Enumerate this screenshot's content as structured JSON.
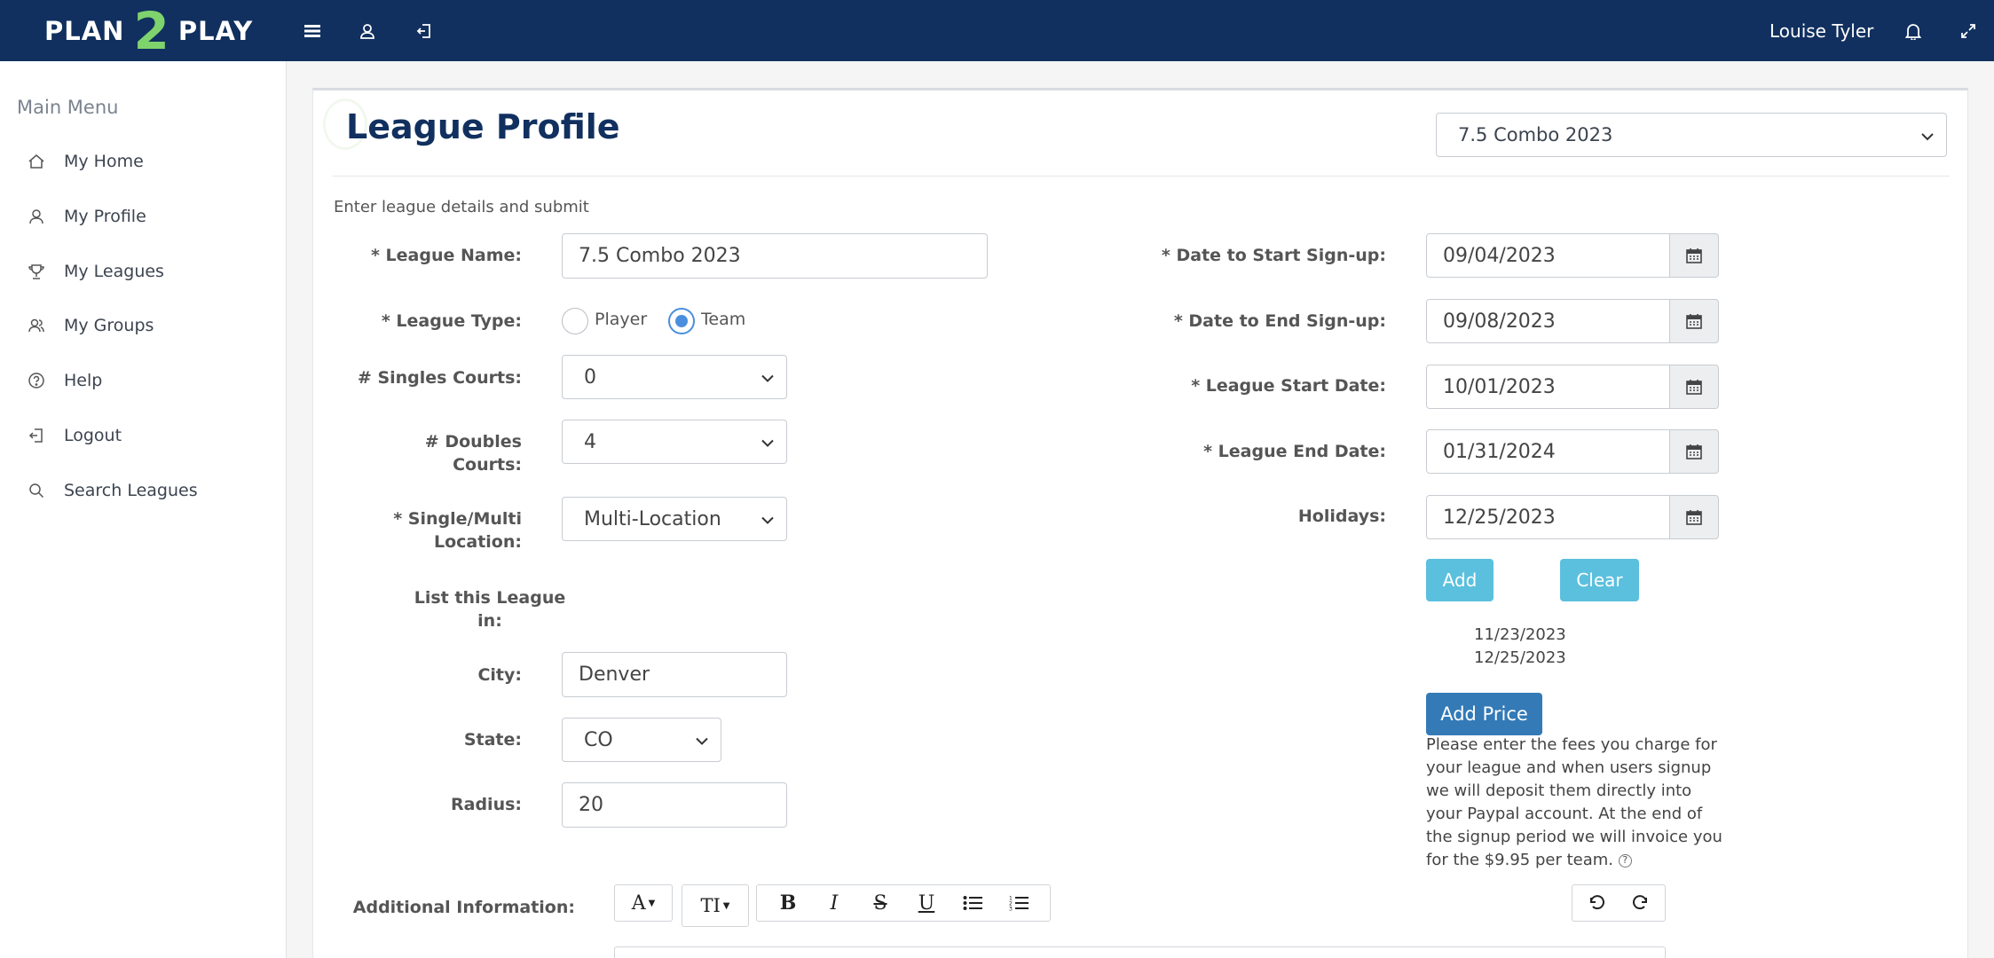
{
  "brand": {
    "left": "PLAN",
    "middle": "2",
    "right": "PLAY"
  },
  "user": {
    "name": "Louise Tyler"
  },
  "sidebar": {
    "title": "Main Menu",
    "items": [
      {
        "label": "My Home",
        "icon": "home-icon"
      },
      {
        "label": "My Profile",
        "icon": "user-icon"
      },
      {
        "label": "My Leagues",
        "icon": "trophy-icon"
      },
      {
        "label": "My Groups",
        "icon": "group-icon"
      },
      {
        "label": "Help",
        "icon": "help-icon"
      },
      {
        "label": "Logout",
        "icon": "logout-icon"
      },
      {
        "label": "Search Leagues",
        "icon": "search-icon"
      }
    ]
  },
  "page": {
    "title": "League Profile",
    "selected_league": "7.5 Combo 2023",
    "intro": "Enter league details and submit"
  },
  "form": {
    "league_name": {
      "label": "* League Name:",
      "value": "7.5 Combo 2023"
    },
    "league_type": {
      "label": "* League Type:",
      "options": [
        "Player",
        "Team"
      ],
      "selected": "Team"
    },
    "singles_courts": {
      "label": "# Singles Courts:",
      "value": "0"
    },
    "doubles_courts": {
      "label_line1": "# Doubles",
      "label_line2": "Courts:",
      "value": "4"
    },
    "location": {
      "label_line1": "* Single/Multi",
      "label_line2": "Location:",
      "value": "Multi-Location"
    },
    "list_in": {
      "label_line1": "List this League",
      "label_line2": "in:"
    },
    "city": {
      "label": "City:",
      "value": "Denver"
    },
    "state": {
      "label": "State:",
      "value": "CO"
    },
    "radius": {
      "label": "Radius:",
      "value": "20"
    },
    "additional_info": {
      "label": "Additional Information:"
    }
  },
  "dates": {
    "signup_start": {
      "label": "* Date to Start Sign-up:",
      "value": "09/04/2023"
    },
    "signup_end": {
      "label": "* Date to End Sign-up:",
      "value": "09/08/2023"
    },
    "league_start": {
      "label": "* League Start Date:",
      "value": "10/01/2023"
    },
    "league_end": {
      "label": "* League End Date:",
      "value": "01/31/2024"
    },
    "holidays": {
      "label": "Holidays:",
      "value": "12/25/2023"
    }
  },
  "holidays": {
    "add_label": "Add",
    "clear_label": "Clear",
    "list": [
      "11/23/2023",
      "12/25/2023"
    ]
  },
  "pricing": {
    "add_price_label": "Add Price",
    "note": "Please enter the fees you charge for your league and when users signup we will deposit them directly into your Paypal account. At the end of the signup period we will invoice you for the $9.95 per team."
  },
  "editor_toolbar": {
    "font_label": "A",
    "size_label": "TI",
    "bold_label": "B",
    "italic_label": "I",
    "strike_label": "S",
    "underline_label": "U"
  },
  "colors": {
    "topbar": "#11305f",
    "brand_accent": "#7ed36d",
    "info_button": "#5bc0de",
    "primary_button": "#337ab7",
    "radio_selected": "#4a8fde"
  }
}
